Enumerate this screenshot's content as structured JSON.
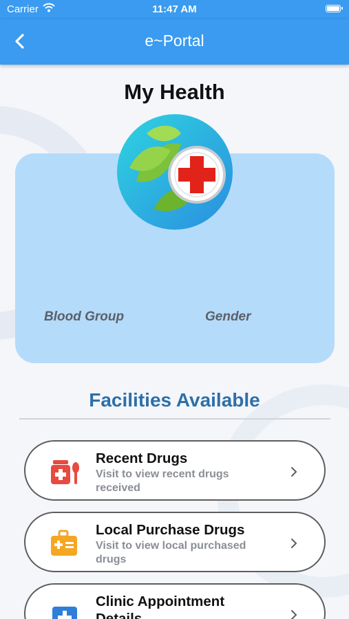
{
  "status_bar": {
    "carrier": "Carrier",
    "time": "11:47 AM",
    "icons": [
      "wifi-icon",
      "battery-icon"
    ]
  },
  "nav": {
    "title": "e~Portal",
    "back_icon": "chevron-left-icon"
  },
  "page": {
    "title": "My Health"
  },
  "profile": {
    "logo_icon": "leaf-medical-cross-logo",
    "blood_group_label": "Blood Group",
    "gender_label": "Gender"
  },
  "facilities": {
    "title": "Facilities Available",
    "items": [
      {
        "title": "Recent Drugs",
        "description": "Visit to view recent drugs received",
        "icon": "medicine-icon",
        "color": "#e84a3f"
      },
      {
        "title": "Local Purchase Drugs",
        "description": "Visit to view local purchased drugs",
        "icon": "medical-kit-icon",
        "color": "#f5a623"
      },
      {
        "title": "Clinic Appointment Details",
        "description": "",
        "icon": "clinic-icon",
        "color": "#2f7fd8"
      }
    ]
  },
  "colors": {
    "header": "#3a9bf0",
    "card": "#b5dbfa",
    "section_title": "#2e6fa8"
  }
}
